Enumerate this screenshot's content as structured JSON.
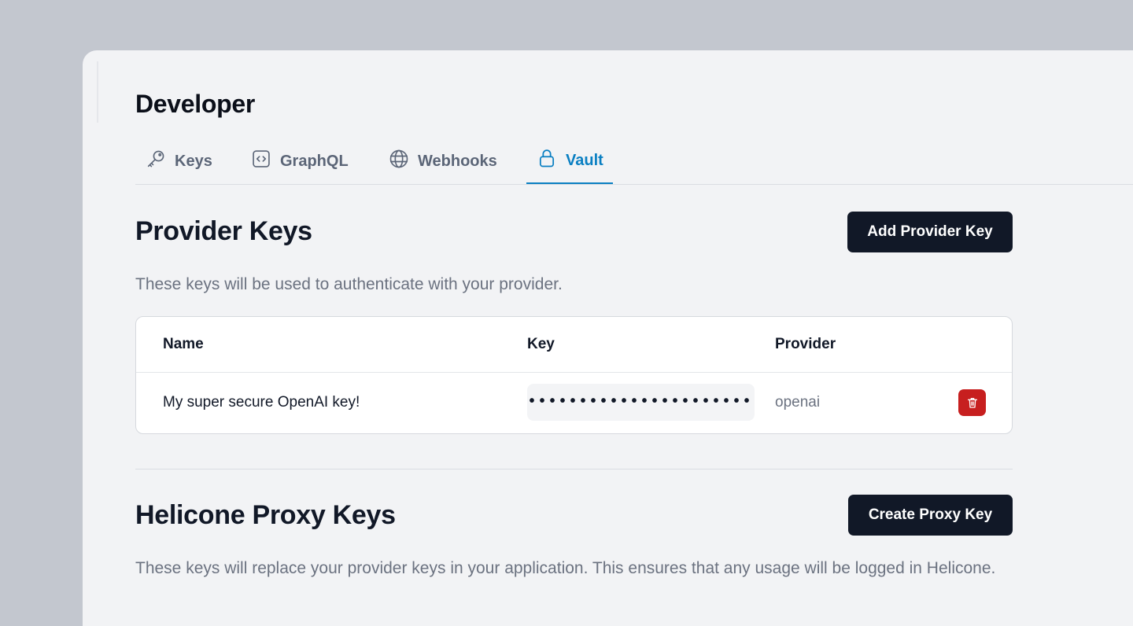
{
  "page": {
    "title": "Developer"
  },
  "tabs": [
    {
      "label": "Keys",
      "icon": "key-icon"
    },
    {
      "label": "GraphQL",
      "icon": "code-icon"
    },
    {
      "label": "Webhooks",
      "icon": "globe-icon"
    },
    {
      "label": "Vault",
      "icon": "lock-icon",
      "active": true
    }
  ],
  "provider_keys": {
    "title": "Provider Keys",
    "add_button": "Add Provider Key",
    "description": "These keys will be used to authenticate with your provider.",
    "columns": [
      "Name",
      "Key",
      "Provider"
    ],
    "rows": [
      {
        "name": "My super secure OpenAI key!",
        "key_masked": "•••••••••••••••••••••••",
        "provider": "openai",
        "delete_icon": "trash-icon"
      }
    ]
  },
  "proxy_keys": {
    "title": "Helicone Proxy Keys",
    "create_button": "Create Proxy Key",
    "description": "These keys will replace your provider keys in your application. This ensures that any usage will be logged in Helicone."
  },
  "colors": {
    "accent": "#0a7fc2",
    "primary_button": "#111827",
    "danger": "#c71f1f",
    "backdrop": "#c3c7cf",
    "panel": "#f2f3f5"
  }
}
